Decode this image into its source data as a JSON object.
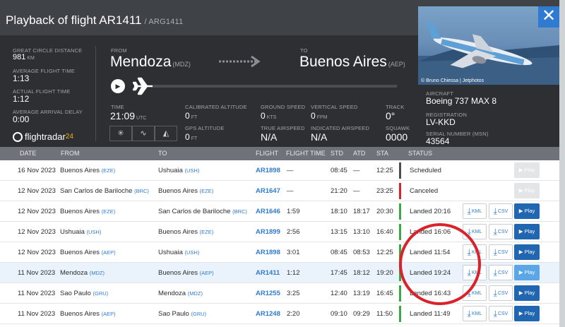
{
  "header": {
    "title": "Playback of flight AR1411",
    "subtitle": "/ ARG1411",
    "close_label": "✕"
  },
  "photo": {
    "credit": "© Bruno Chiessa | Jetphotos"
  },
  "stats": {
    "great_circle_label": "GREAT CIRCLE DISTANCE",
    "great_circle_value": "981",
    "great_circle_unit": "KM",
    "avg_flight_label": "AVERAGE FLIGHT TIME",
    "avg_flight_value": "1:13",
    "actual_flight_label": "ACTUAL FLIGHT TIME",
    "actual_flight_value": "1:12",
    "avg_delay_label": "AVERAGE ARRIVAL DELAY",
    "avg_delay_value": "0:00"
  },
  "route": {
    "from_label": "FROM",
    "from_city": "Mendoza",
    "from_code": "(MDZ)",
    "to_label": "TO",
    "to_city": "Buenos Aires",
    "to_code": "(AEP)"
  },
  "readouts": {
    "time_label": "TIME",
    "time_value": "21:09",
    "time_unit": "UTC",
    "cal_alt_label": "CALIBRATED ALTITUDE",
    "cal_alt_value": "0",
    "cal_alt_unit": "FT",
    "gps_alt_label": "GPS ALTITUDE",
    "gps_alt_value": "0",
    "gps_alt_unit": "FT",
    "ground_speed_label": "GROUND SPEED",
    "ground_speed_value": "0",
    "ground_speed_unit": "KTS",
    "true_airspeed_label": "TRUE AIRSPEED",
    "true_airspeed_value": "N/A",
    "vertical_speed_label": "VERTICAL SPEED",
    "vertical_speed_value": "0",
    "vertical_speed_unit": "FPM",
    "indicated_airspeed_label": "INDICATED AIRSPEED",
    "indicated_airspeed_value": "N/A",
    "track_label": "TRACK",
    "track_value": "0°",
    "squawk_label": "SQUAWK",
    "squawk_value": "0000"
  },
  "aircraft": {
    "aircraft_label": "AIRCRAFT",
    "aircraft_value": "Boeing 737 MAX 8",
    "registration_label": "REGISTRATION",
    "registration_value": "LV-KKD",
    "serial_label": "SERIAL NUMBER (MSN)",
    "serial_value": "43564"
  },
  "logo": {
    "text": "flightradar",
    "num": "24"
  },
  "table": {
    "headers": [
      "DATE",
      "FROM",
      "TO",
      "FLIGHT",
      "FLIGHT TIME",
      "STD",
      "ATD",
      "STA",
      "STATUS"
    ],
    "rows": [
      {
        "date": "16 Nov 2023",
        "from": "Buenos Aires",
        "from_code": "(EZE)",
        "to": "Ushuaia",
        "to_code": "(USH)",
        "flight": "AR1898",
        "ftime": "—",
        "std": "08:45",
        "atd": "—",
        "sta": "12:25",
        "status": "Scheduled",
        "status_color": "#4a4d52",
        "kml": false,
        "csv": false,
        "play": "▶ Play",
        "play_state": "disabled"
      },
      {
        "date": "12 Nov 2023",
        "from": "San Carlos de Bariloche",
        "from_code": "(BRC)",
        "to": "Buenos Aires",
        "to_code": "(EZE)",
        "flight": "AR1647",
        "ftime": "—",
        "std": "21:20",
        "atd": "—",
        "sta": "23:25",
        "status": "Canceled",
        "status_color": "#d9222a",
        "kml": false,
        "csv": false,
        "play": "▶ Play",
        "play_state": "disabled"
      },
      {
        "date": "12 Nov 2023",
        "from": "Buenos Aires",
        "from_code": "(EZE)",
        "to": "San Carlos de Bariloche",
        "to_code": "(BRC)",
        "flight": "AR1646",
        "ftime": "1:59",
        "std": "18:10",
        "atd": "18:17",
        "sta": "20:30",
        "status": "Landed 20:16",
        "status_color": "#3aa845",
        "kml": true,
        "csv": true,
        "play": "▶ Play",
        "play_state": "active"
      },
      {
        "date": "12 Nov 2023",
        "from": "Ushuaia",
        "from_code": "(USH)",
        "to": "Buenos Aires",
        "to_code": "(EZE)",
        "flight": "AR1899",
        "ftime": "2:56",
        "std": "13:15",
        "atd": "13:10",
        "sta": "16:40",
        "status": "Landed 16:06",
        "status_color": "#3aa845",
        "kml": true,
        "csv": true,
        "play": "▶ Play",
        "play_state": "active"
      },
      {
        "date": "12 Nov 2023",
        "from": "Buenos Aires",
        "from_code": "(AEP)",
        "to": "Ushuaia",
        "to_code": "(USH)",
        "flight": "AR1898",
        "ftime": "3:01",
        "std": "08:45",
        "atd": "08:53",
        "sta": "12:25",
        "status": "Landed 11:54",
        "status_color": "#3aa845",
        "kml": true,
        "csv": true,
        "play": "▶ Play",
        "play_state": "active"
      },
      {
        "date": "11 Nov 2023",
        "from": "Mendoza",
        "from_code": "(MDZ)",
        "to": "Buenos Aires",
        "to_code": "(AEP)",
        "flight": "AR1411",
        "ftime": "1:12",
        "std": "17:45",
        "atd": "18:12",
        "sta": "19:20",
        "status": "Landed 19:24",
        "status_color": "#3aa845",
        "kml": true,
        "csv": true,
        "play": "▶ Play",
        "play_state": "light"
      },
      {
        "date": "11 Nov 2023",
        "from": "Sao Paulo",
        "from_code": "(GRU)",
        "to": "Mendoza",
        "to_code": "(MDZ)",
        "flight": "AR1255",
        "ftime": "3:25",
        "std": "12:40",
        "atd": "13:19",
        "sta": "16:45",
        "status": "Landed 16:43",
        "status_color": "#3aa845",
        "kml": true,
        "csv": true,
        "play": "▶ Play",
        "play_state": "active"
      },
      {
        "date": "11 Nov 2023",
        "from": "Buenos Aires",
        "from_code": "(AEP)",
        "to": "Sao Paulo",
        "to_code": "(GRU)",
        "flight": "AR1248",
        "ftime": "2:20",
        "std": "09:10",
        "atd": "09:29",
        "sta": "11:50",
        "status": "Landed 11:49",
        "status_color": "#3aa845",
        "kml": true,
        "csv": true,
        "play": "▶ Play",
        "play_state": "active"
      }
    ],
    "kml_label": "KML",
    "csv_label": "CSV"
  }
}
